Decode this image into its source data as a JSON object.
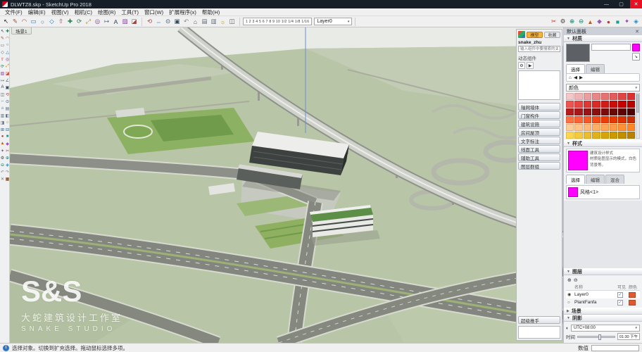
{
  "titlebar": {
    "title": "DLWTZ8.skp - SketchUp Pro 2018",
    "minimize": "—",
    "maximize": "▢",
    "close": "✕"
  },
  "menubar": {
    "items": [
      "文件(F)",
      "编辑(E)",
      "视图(V)",
      "相机(C)",
      "绘图(R)",
      "工具(T)",
      "窗口(W)",
      "扩展程序(x)",
      "帮助(H)"
    ]
  },
  "toolbar": {
    "scale_text": "1 2 3 4 5 6 7 8 9 10 1/2 1/4 1/8 1/16",
    "layer_dropdown": "Layer0",
    "icons_left": [
      {
        "name": "select-tool-icon",
        "glyph": "↖",
        "color": "#2b2b2b"
      },
      {
        "name": "line-tool-icon",
        "glyph": "✎",
        "color": "#a0522d"
      },
      {
        "name": "arc-tool-icon",
        "glyph": "◠",
        "color": "#a0522d"
      },
      {
        "name": "rectangle-tool-icon",
        "glyph": "▭",
        "color": "#1f6fb5"
      },
      {
        "name": "circle-tool-icon",
        "glyph": "○",
        "color": "#1f6fb5"
      },
      {
        "name": "polygon-tool-icon",
        "glyph": "◇",
        "color": "#1f6fb5"
      },
      {
        "name": "pushpull-tool-icon",
        "glyph": "⇧",
        "color": "#c0392b"
      },
      {
        "name": "move-tool-icon",
        "glyph": "✚",
        "color": "#1e8449"
      },
      {
        "name": "rotate-tool-icon",
        "glyph": "⟳",
        "color": "#1e8449"
      },
      {
        "name": "scale-tool-icon",
        "glyph": "⤢",
        "color": "#b9770e"
      },
      {
        "name": "offset-tool-icon",
        "glyph": "◎",
        "color": "#7d3c98"
      },
      {
        "name": "tape-measure-icon",
        "glyph": "↦",
        "color": "#566573"
      },
      {
        "name": "text-tool-icon",
        "glyph": "A",
        "color": "#2c3e50"
      },
      {
        "name": "paint-bucket-icon",
        "glyph": "▨",
        "color": "#8e44ad"
      },
      {
        "name": "eraser-tool-icon",
        "glyph": "◪",
        "color": "#c0392b"
      }
    ],
    "icons_mid": [
      {
        "name": "orbit-tool-icon",
        "glyph": "⟲",
        "color": "#c0392b"
      },
      {
        "name": "pan-tool-icon",
        "glyph": "⇔",
        "color": "#2e86c1"
      },
      {
        "name": "zoom-tool-icon",
        "glyph": "⊙",
        "color": "#34495e"
      },
      {
        "name": "zoom-extents-icon",
        "glyph": "▣",
        "color": "#34495e"
      },
      {
        "name": "previous-view-icon",
        "glyph": "↶",
        "color": "#7f8c8d"
      },
      {
        "name": "iso-view-icon",
        "glyph": "⌂",
        "color": "#2c3e50"
      },
      {
        "name": "top-view-icon",
        "glyph": "▤",
        "color": "#5d6d7e"
      },
      {
        "name": "front-view-icon",
        "glyph": "▥",
        "color": "#5d6d7e"
      },
      {
        "name": "shadows-toggle-icon",
        "glyph": "☼",
        "color": "#b7950b"
      },
      {
        "name": "section-plane-icon",
        "glyph": "◫",
        "color": "#515a5a"
      }
    ],
    "icons_right": [
      {
        "name": "plugin-icon-1",
        "glyph": "✂",
        "color": "#c0392b"
      },
      {
        "name": "plugin-icon-2",
        "glyph": "⚙",
        "color": "#444444"
      },
      {
        "name": "plugin-icon-3",
        "glyph": "⊕",
        "color": "#117864"
      },
      {
        "name": "plugin-icon-4",
        "glyph": "⊖",
        "color": "#117864"
      },
      {
        "name": "plugin-icon-5",
        "glyph": "▲",
        "color": "#d35400"
      },
      {
        "name": "plugin-icon-6",
        "glyph": "◆",
        "color": "#9b59b6"
      },
      {
        "name": "plugin-icon-7",
        "glyph": "●",
        "color": "#c0392b"
      },
      {
        "name": "plugin-icon-8",
        "glyph": "■",
        "color": "#16a085"
      },
      {
        "name": "plugin-icon-9",
        "glyph": "✦",
        "color": "#8e44ad"
      },
      {
        "name": "plugin-icon-10",
        "glyph": "◈",
        "color": "#2e86c1"
      }
    ]
  },
  "toolpalette": {
    "icons": [
      {
        "name": "select-tool-icon",
        "glyph": "↖",
        "color": "#333333"
      },
      {
        "name": "move-tool-icon",
        "glyph": "✚",
        "color": "#1e8449"
      },
      {
        "name": "line-tool-icon",
        "glyph": "✎",
        "color": "#a0522d"
      },
      {
        "name": "arc-tool-icon",
        "glyph": "◠",
        "color": "#a0522d"
      },
      {
        "name": "rectangle-tool-icon",
        "glyph": "▭",
        "color": "#1f6fb5"
      },
      {
        "name": "circle-tool-icon",
        "glyph": "○",
        "color": "#1f6fb5"
      },
      {
        "name": "polygon-tool-icon",
        "glyph": "◇",
        "color": "#1f6fb5"
      },
      {
        "name": "triangle-tool-icon",
        "glyph": "△",
        "color": "#1f6fb5"
      },
      {
        "name": "pushpull-tool-icon",
        "glyph": "⇧",
        "color": "#c0392b"
      },
      {
        "name": "offset-tool-icon",
        "glyph": "◎",
        "color": "#7d3c98"
      },
      {
        "name": "rotate-tool-icon",
        "glyph": "⟳",
        "color": "#1e8449"
      },
      {
        "name": "scale-tool-icon",
        "glyph": "⤢",
        "color": "#b9770e"
      },
      {
        "name": "paint-bucket-icon",
        "glyph": "▨",
        "color": "#8e44ad"
      },
      {
        "name": "eraser-tool-icon",
        "glyph": "◪",
        "color": "#c0392b"
      },
      {
        "name": "tape-measure-icon",
        "glyph": "↦",
        "color": "#566573"
      },
      {
        "name": "protractor-icon",
        "glyph": "∠",
        "color": "#566573"
      },
      {
        "name": "text-tool-icon",
        "glyph": "A",
        "color": "#2c3e50"
      },
      {
        "name": "zoom-window-icon",
        "glyph": "▣",
        "color": "#34495e"
      },
      {
        "name": "section-plane-icon",
        "glyph": "◫",
        "color": "#515a5a"
      },
      {
        "name": "orbit-tool-icon",
        "glyph": "⟲",
        "color": "#c0392b"
      },
      {
        "name": "pan-tool-icon",
        "glyph": "⇔",
        "color": "#2e86c1"
      },
      {
        "name": "zoom-tool-icon",
        "glyph": "⊙",
        "color": "#34495e"
      },
      {
        "name": "home-view-icon",
        "glyph": "⌂",
        "color": "#2c3e50"
      },
      {
        "name": "top-view-icon",
        "glyph": "▤",
        "color": "#5d6d7e"
      },
      {
        "name": "front-view-icon",
        "glyph": "▥",
        "color": "#5d6d7e"
      },
      {
        "name": "left-view-icon",
        "glyph": "◧",
        "color": "#5d6d7e"
      },
      {
        "name": "right-view-icon",
        "glyph": "◨",
        "color": "#5d6d7e"
      },
      {
        "name": "shadows-toggle-icon",
        "glyph": "☼",
        "color": "#b7950b"
      },
      {
        "name": "add-tool-icon",
        "glyph": "⊞",
        "color": "#1f618d"
      },
      {
        "name": "subtract-tool-icon",
        "glyph": "⊟",
        "color": "#1f618d"
      },
      {
        "name": "point-tool-icon",
        "glyph": "●",
        "color": "#c0392b"
      },
      {
        "name": "solid-tool-icon",
        "glyph": "■",
        "color": "#16a085"
      },
      {
        "name": "wedge-tool-icon",
        "glyph": "▲",
        "color": "#d35400"
      },
      {
        "name": "gem-tool-icon",
        "glyph": "◆",
        "color": "#9b59b6"
      },
      {
        "name": "star-tool-icon",
        "glyph": "✦",
        "color": "#8e44ad"
      },
      {
        "name": "trim-tool-icon",
        "glyph": "✂",
        "color": "#c0392b"
      },
      {
        "name": "settings-tool-icon",
        "glyph": "⚙",
        "color": "#444444"
      },
      {
        "name": "union-tool-icon",
        "glyph": "⊕",
        "color": "#117864"
      },
      {
        "name": "difference-tool-icon",
        "glyph": "⊖",
        "color": "#117864"
      },
      {
        "name": "intersect-tool-icon",
        "glyph": "◈",
        "color": "#2e86c1"
      },
      {
        "name": "undo-icon",
        "glyph": "↶",
        "color": "#7f8c8d"
      },
      {
        "name": "redo-icon",
        "glyph": "↷",
        "color": "#7f8c8d"
      },
      {
        "name": "close-tool-icon",
        "glyph": "✕",
        "color": "#777777"
      },
      {
        "name": "grid-tool-icon",
        "glyph": "▦",
        "color": "#6e2c00"
      }
    ]
  },
  "viewport": {
    "scene_tab": "场景1",
    "watermark_logo": "S&S",
    "watermark_cn": "大蛇建筑设计工作室",
    "watermark_en": "SNAKE STUDIO"
  },
  "float_panel": {
    "chip1": "模型",
    "chip2": "收藏",
    "title": "snake_zhu",
    "search_placeholder": "输入组件中要搜索的关键字",
    "dynamic_label": "动态组件",
    "rollouts": [
      "轴网墙体",
      "门窗构件",
      "建筑设施",
      "房间屋顶",
      "文字标注",
      "线面工具",
      "辅助工具",
      "图层群组"
    ],
    "bottom_rollout": "超级推手"
  },
  "tray": {
    "title": "默认面板",
    "close": "✕",
    "materials": {
      "title": "材质",
      "name": "",
      "tabs": [
        "选择",
        "编辑"
      ],
      "dropdown": "颜色",
      "palette": [
        "#f2c9c9",
        "#efb3b3",
        "#ec9d9d",
        "#e98787",
        "#e67171",
        "#e35b5b",
        "#e04545",
        "#dd2f2f",
        "#ef5350",
        "#e84542",
        "#e13734",
        "#da2926",
        "#d31b18",
        "#cc0d0a",
        "#c50200",
        "#b80200",
        "#b71c1c",
        "#a81818",
        "#991414",
        "#8a1010",
        "#7b0c0c",
        "#6c0808",
        "#5d0404",
        "#4e0000",
        "#ff7043",
        "#fb6334",
        "#f75625",
        "#f34916",
        "#ef3c07",
        "#e83600",
        "#d93200",
        "#ca2e00",
        "#ffcc99",
        "#ffc288",
        "#ffb877",
        "#ffae66",
        "#ffa455",
        "#ff9a44",
        "#ff9033",
        "#ff8622",
        "#ffd54f",
        "#f5c93e",
        "#ebbd2d",
        "#e1b11c",
        "#d7a50b",
        "#cd9900",
        "#c38d00",
        "#b98100"
      ]
    },
    "styles": {
      "title": "样式",
      "desc1": "建筑设计样式",
      "desc2": "材质贴图显示的模式，白色背景等。",
      "tabs": [
        "选择",
        "编辑",
        "混合"
      ],
      "style_name": "风格<1>"
    },
    "layers": {
      "title": "图层",
      "add": "⊕",
      "remove": "⊖",
      "columns": [
        "名称",
        "可见",
        "颜色"
      ],
      "rows": [
        {
          "name": "Layer0",
          "current": true,
          "visible": true,
          "color": "#e2582f"
        },
        {
          "name": "PlantFanfa",
          "current": false,
          "visible": true,
          "color": "#e2582f"
        }
      ]
    },
    "scenes": {
      "title": "场景"
    },
    "shadows": {
      "title": "阴影",
      "timezone": "UTC+08:00",
      "time_label": "时间",
      "time_value": "01:30 下午"
    }
  },
  "statusbar": {
    "hint": "选择对象。切换到扩充选择。拖动鼠标选择多项。",
    "measure_label": "数值",
    "measure_value": ""
  }
}
